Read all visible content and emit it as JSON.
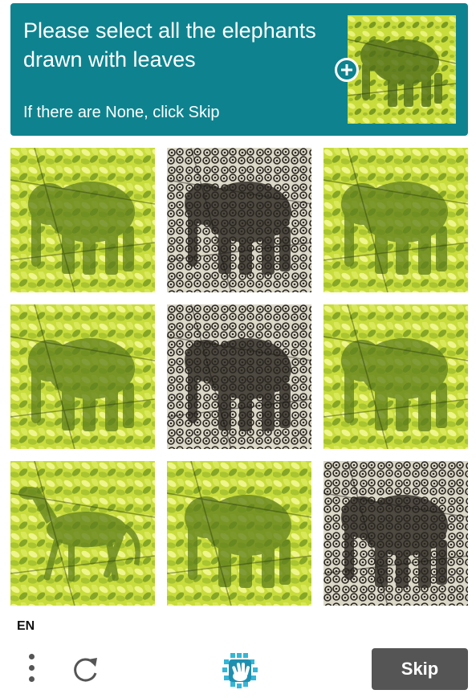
{
  "header": {
    "prompt": "Please select all the elephants drawn with leaves",
    "sub": "If there are None, click Skip",
    "example_alt": "Example image: elephant drawn with leaves"
  },
  "grid": {
    "tiles": [
      {
        "style": "leaves",
        "subject": "elephant"
      },
      {
        "style": "swirls",
        "subject": "elephant"
      },
      {
        "style": "leaves",
        "subject": "elephant"
      },
      {
        "style": "leaves",
        "subject": "elephant"
      },
      {
        "style": "swirls",
        "subject": "elephant"
      },
      {
        "style": "leaves",
        "subject": "elephant"
      },
      {
        "style": "leaves",
        "subject": "horse"
      },
      {
        "style": "leaves",
        "subject": "elephant"
      },
      {
        "style": "swirls",
        "subject": "elephant"
      }
    ]
  },
  "footer": {
    "language": "EN",
    "skip_label": "Skip"
  },
  "colors": {
    "header_bg": "#0e838f",
    "skip_bg": "#555555",
    "leaf_light": "#c8dc3c",
    "leaf_dark": "#5f7f1e",
    "swirl_light": "#dcd8c8",
    "swirl_dark": "#2a2620"
  }
}
